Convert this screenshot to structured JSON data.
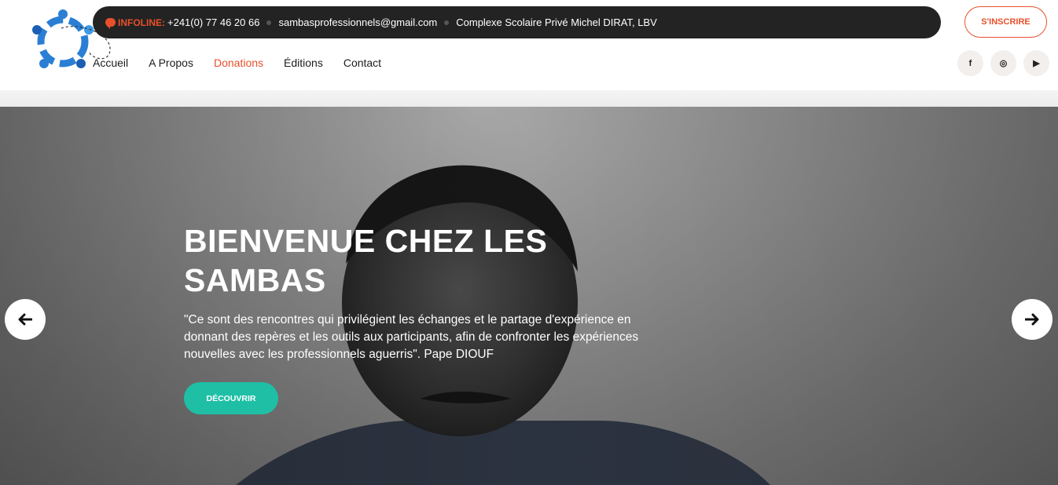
{
  "header": {
    "infobar": {
      "infoline_label": "INFOLINE:",
      "phone": "+241(0) 77 46 20 66",
      "email": "sambasprofessionnels@gmail.com",
      "address": "Complexe Scolaire Privé Michel DIRAT, LBV"
    },
    "signup_label": "S'INSCRIRE",
    "nav": [
      {
        "label": "Accueil"
      },
      {
        "label": "A Propos"
      },
      {
        "label": "Donations"
      },
      {
        "label": "Éditions"
      },
      {
        "label": "Contact"
      }
    ],
    "socials": [
      {
        "icon": "facebook-icon",
        "glyph": "f"
      },
      {
        "icon": "instagram-icon",
        "glyph": "◎"
      },
      {
        "icon": "youtube-icon",
        "glyph": "▶"
      }
    ]
  },
  "hero": {
    "title_line1": "BIENVENUE CHEZ LES",
    "title_line2": "SAMBAS",
    "quote": "\"Ce sont des rencontres qui privilégient les échanges et le partage d'expérience en donnant des repères et les outils aux participants, afin de confronter les expériences nouvelles avec les professionnels aguerris\". Pape DIOUF",
    "button_label": "DÉCOUVRIR"
  },
  "colors": {
    "accent": "#e8502b",
    "teal": "#1fbfa6",
    "dark": "#232323",
    "logo_blue": "#2a7fd4"
  }
}
